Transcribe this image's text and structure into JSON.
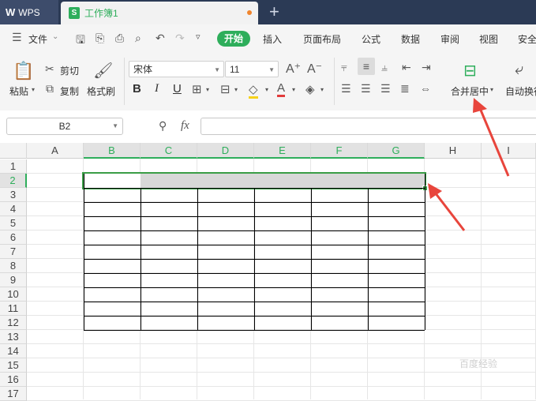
{
  "tabs": {
    "app_logo": "W",
    "app_name": "WPS",
    "doc_icon": "S",
    "doc_name": "工作簿1",
    "add": "+"
  },
  "menu": {
    "file": "文件",
    "items": [
      "开始",
      "插入",
      "页面布局",
      "公式",
      "数据",
      "审阅",
      "视图",
      "安全"
    ]
  },
  "ribbon": {
    "paste": "粘贴",
    "cut": "剪切",
    "copy": "复制",
    "format_painter": "格式刷",
    "font_name": "宋体",
    "font_size": "11",
    "bold": "B",
    "italic": "I",
    "underline": "U",
    "merge_center": "合并居中",
    "wrap_text": "自动换行"
  },
  "formula_bar": {
    "cell_ref": "B2",
    "fx": "fx",
    "value": ""
  },
  "sheet": {
    "columns": [
      "A",
      "B",
      "C",
      "D",
      "E",
      "F",
      "G",
      "H",
      "I"
    ],
    "selected_columns": [
      "B",
      "C",
      "D",
      "E",
      "F",
      "G"
    ],
    "rows": [
      "1",
      "2",
      "3",
      "4",
      "5",
      "6",
      "7",
      "8",
      "9",
      "10",
      "11",
      "12",
      "13",
      "14",
      "15",
      "16",
      "17"
    ],
    "selected_row": "2",
    "selection": "B2:G2"
  },
  "colors": {
    "accent": "#2eae5b",
    "arrow": "#e8453c"
  },
  "watermark": "百度经验"
}
